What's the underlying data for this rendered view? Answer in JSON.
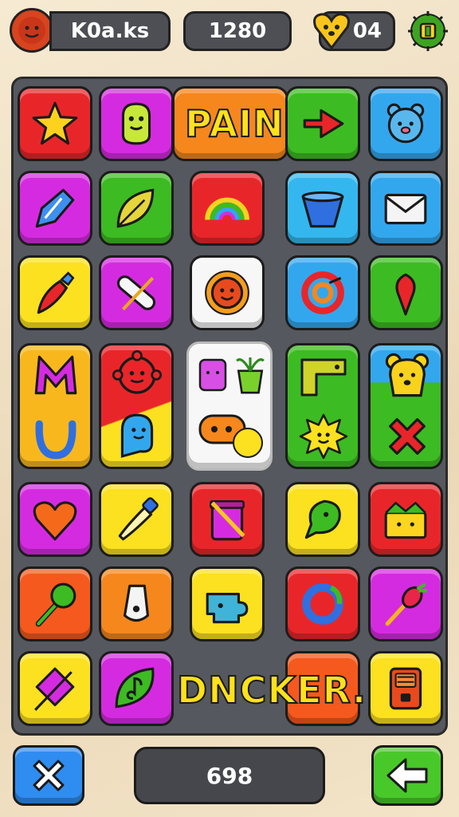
{
  "header": {
    "player_name": "K0a.ks",
    "score": "1280",
    "lives": "04"
  },
  "board": {
    "word_top": "PAIN",
    "word_bottom": "DNCKER."
  },
  "footer": {
    "counter": "698"
  },
  "colors": {
    "red": "#e8262a",
    "magenta": "#d52be0",
    "orange": "#f5871d",
    "green": "#3dbb22",
    "blue": "#33a7ee",
    "yellow": "#fbe11f",
    "board": "#55585e"
  },
  "icons": [
    "star",
    "cactus-face",
    "arrow",
    "bear-face",
    "pen-nib",
    "leaf",
    "rainbow",
    "cup",
    "envelope",
    "carrot",
    "bandage",
    "sun-face",
    "swirl",
    "balloon",
    "letter-m",
    "horseshoe",
    "virus-face",
    "ghost",
    "potted-plants",
    "gamepad",
    "bracket",
    "spiky-face",
    "bear-face",
    "cross",
    "heart",
    "brush",
    "jar",
    "leaf-drop",
    "box-face",
    "lollipop",
    "whistle",
    "puzzle-piece",
    "ring",
    "radish",
    "kite",
    "music-note",
    "radio"
  ]
}
